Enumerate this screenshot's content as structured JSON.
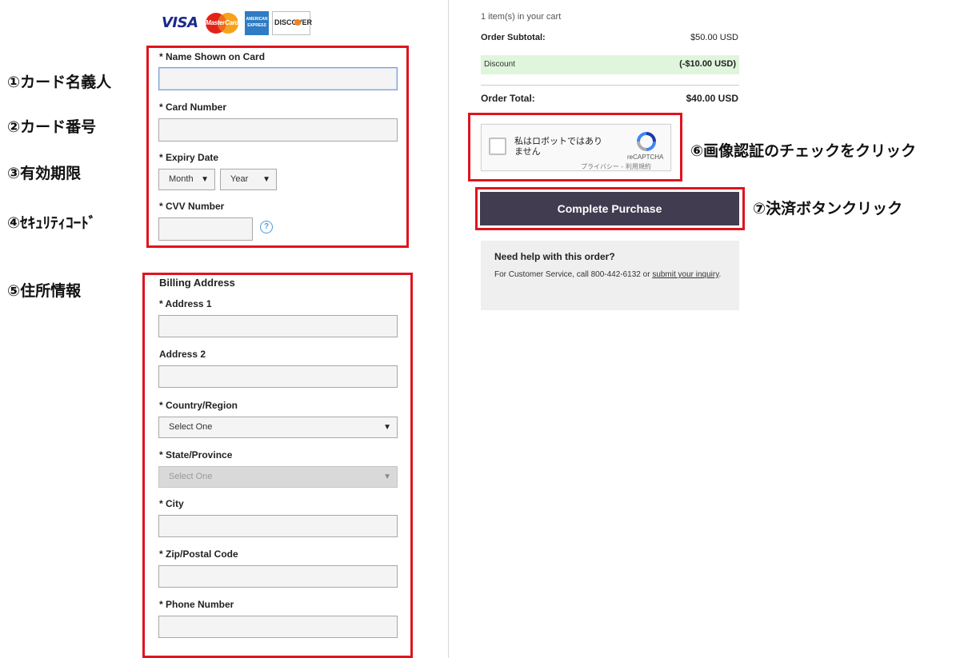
{
  "annotations": {
    "a1": "①カード名義人",
    "a2": "②カード番号",
    "a3": "③有効期限",
    "a4": "④ｾｷｭﾘﾃｨｺｰﾄﾞ",
    "a5": "⑤住所情報",
    "a6": "⑥画像認証のチェックをクリック",
    "a7": "⑦決済ボタンクリック"
  },
  "cards": {
    "visa": "VISA",
    "mastercard": "MasterCard",
    "amex": "AMERICAN EXPRESS",
    "discover": "DISCOVER"
  },
  "payment": {
    "name_label": "* Name Shown on Card",
    "card_number_label": "* Card Number",
    "expiry_label": "* Expiry Date",
    "month_value": "Month",
    "year_value": "Year",
    "cvv_label": "* CVV Number",
    "cvv_help": "?"
  },
  "billing": {
    "heading": "Billing Address",
    "address1_label": "* Address 1",
    "address2_label": "Address 2",
    "country_label": "* Country/Region",
    "country_value": "Select One",
    "state_label": "* State/Province",
    "state_value": "Select One",
    "city_label": "* City",
    "zip_label": "* Zip/Postal Code",
    "phone_label": "* Phone Number"
  },
  "order": {
    "cart_count": "1 item(s) in your cart",
    "subtotal_label": "Order Subtotal:",
    "subtotal_value": "$50.00 USD",
    "discount_label": "Discount",
    "discount_value": "(-$10.00 USD)",
    "total_label": "Order Total:",
    "total_value": "$40.00 USD"
  },
  "recaptcha": {
    "checkbox_text": "私はロボットではありません",
    "brand": "reCAPTCHA",
    "privacy": "プライバシー",
    "sep": " - ",
    "terms": "利用規約"
  },
  "purchase_button": "Complete Purchase",
  "help": {
    "title": "Need help with this order?",
    "text_prefix": "For Customer Service, call 800-442-6132 or ",
    "link_text": "submit your inquiry",
    "text_suffix": "."
  },
  "colors": {
    "highlight": "#e0141e",
    "button_bg": "#413c4f",
    "discount_bg": "#dff5dc"
  }
}
